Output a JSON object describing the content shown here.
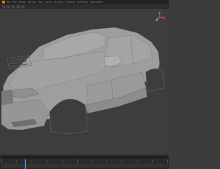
{
  "menubar": {
    "items": [
      "File",
      "Edit",
      "Render",
      "Window",
      "Help",
      "Layout",
      "Modeling",
      "Sculpting",
      "UV Editing",
      "Texture Paint"
    ]
  },
  "icons": {
    "app": "blender-logo-icon",
    "gizmo": "navigation-gizmo-icon"
  },
  "colors": {
    "accent": "#e87d0d",
    "viewport_bg": "#3d3d3d",
    "model": "#9e9e9e",
    "playhead": "#4a8ad8"
  },
  "viewport": {
    "object": "car-body-model"
  }
}
